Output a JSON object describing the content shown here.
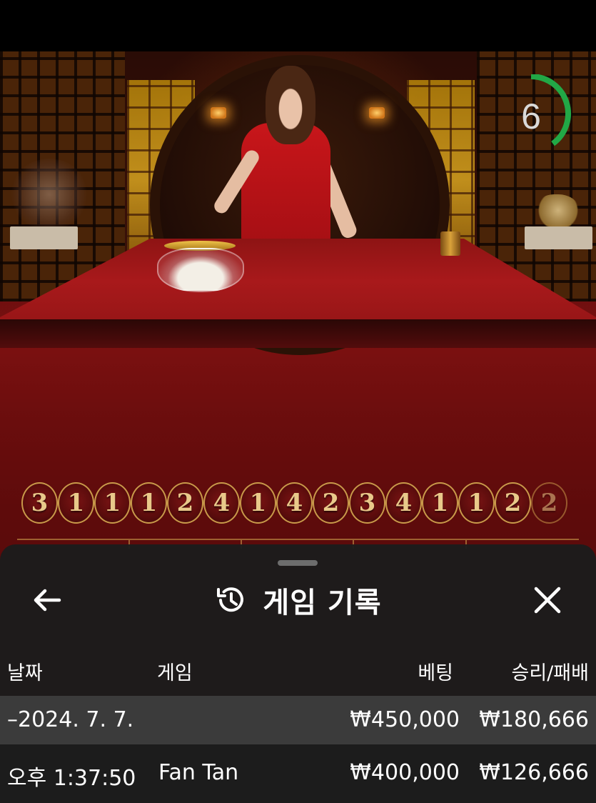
{
  "timer": {
    "seconds": "6",
    "fraction_remaining": 0.4,
    "ring_color": "#22a846"
  },
  "history": {
    "results": [
      "3",
      "1",
      "1",
      "1",
      "2",
      "4",
      "1",
      "4",
      "2",
      "3",
      "4",
      "1",
      "1",
      "2",
      "2"
    ]
  },
  "sheet": {
    "title": "게임 기록",
    "history_icon": "history-clock-icon",
    "back_icon": "arrow-left-icon",
    "close_icon": "close-x-icon",
    "columns": {
      "date": "날짜",
      "game": "게임",
      "bet": "베팅",
      "result": "승리/패배"
    },
    "day_group": {
      "date": "–2024. 7. 7.",
      "bet": "₩450,000",
      "result": "₩180,666"
    },
    "rows": [
      {
        "time": "오후 1:37:50",
        "game": "Fan Tan",
        "bet": "₩400,000",
        "result": "₩126,666"
      }
    ]
  },
  "colors": {
    "sheet_bg": "#1c1c1c",
    "day_row_bg": "#3b3b3b",
    "bead_gold": "#c99a4a",
    "felt": "#7a1010"
  }
}
